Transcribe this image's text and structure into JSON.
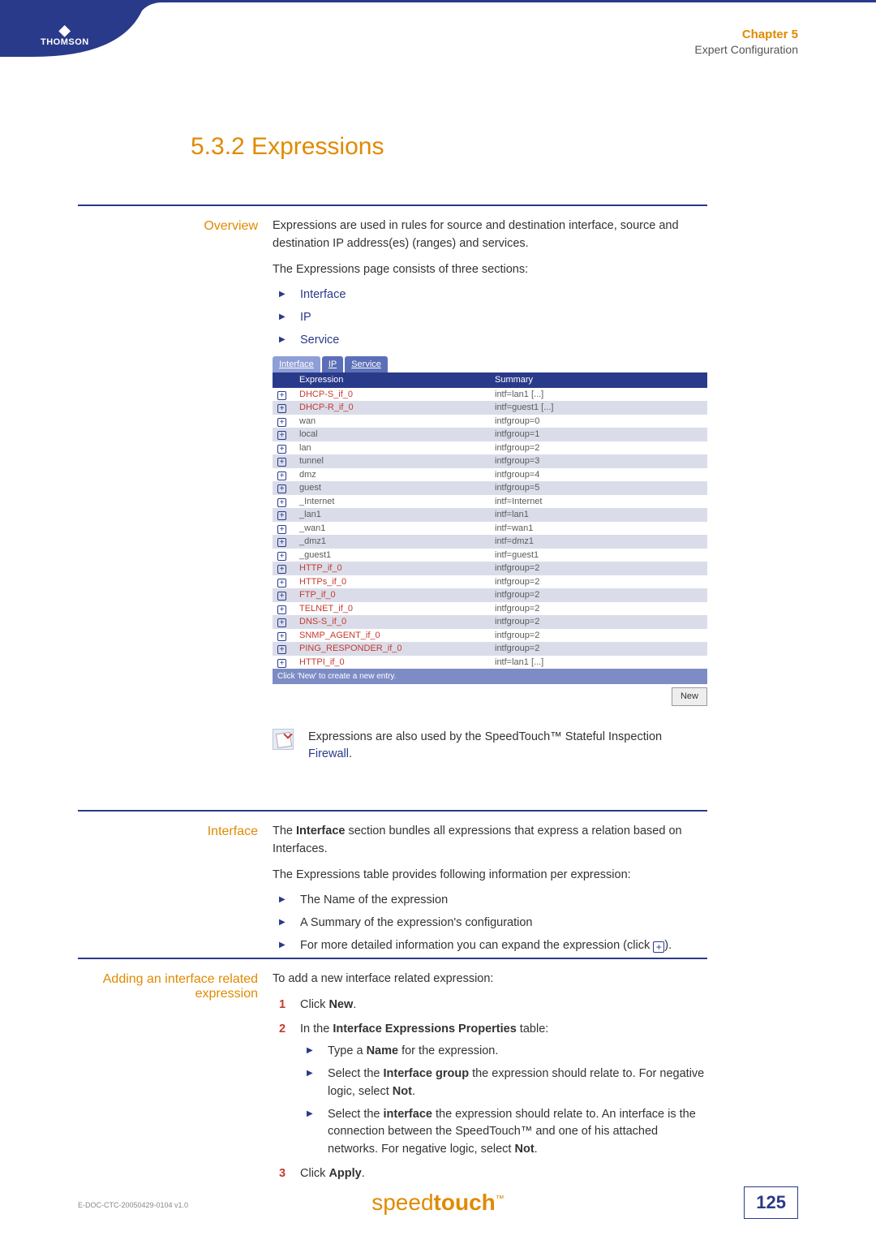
{
  "header": {
    "logo_text": "THOMSON",
    "chapter": "Chapter 5",
    "subtitle": "Expert Configuration"
  },
  "heading": "5.3.2  Expressions",
  "overview": {
    "label": "Overview",
    "para1": "Expressions are used in rules for source and destination interface, source and destination IP address(es) (ranges) and services.",
    "para2": "The Expressions page consists of three sections:",
    "items": [
      "Interface",
      "IP",
      "Service"
    ]
  },
  "screenshot": {
    "tabs": [
      "Interface",
      "IP",
      "Service"
    ],
    "active_tab": 0,
    "columns": [
      "Expression",
      "Summary"
    ],
    "rows": [
      {
        "expr": "DHCP-S_if_0",
        "sum": "intf=lan1 [...]",
        "red": true
      },
      {
        "expr": "DHCP-R_if_0",
        "sum": "intf=guest1 [...]",
        "red": true
      },
      {
        "expr": "wan",
        "sum": "intfgroup=0",
        "red": false
      },
      {
        "expr": "local",
        "sum": "intfgroup=1",
        "red": false
      },
      {
        "expr": "lan",
        "sum": "intfgroup=2",
        "red": false
      },
      {
        "expr": "tunnel",
        "sum": "intfgroup=3",
        "red": false
      },
      {
        "expr": "dmz",
        "sum": "intfgroup=4",
        "red": false
      },
      {
        "expr": "guest",
        "sum": "intfgroup=5",
        "red": false
      },
      {
        "expr": "_Internet",
        "sum": "intf=Internet",
        "red": false
      },
      {
        "expr": "_lan1",
        "sum": "intf=lan1",
        "red": false
      },
      {
        "expr": "_wan1",
        "sum": "intf=wan1",
        "red": false
      },
      {
        "expr": "_dmz1",
        "sum": "intf=dmz1",
        "red": false
      },
      {
        "expr": "_guest1",
        "sum": "intf=guest1",
        "red": false
      },
      {
        "expr": "HTTP_if_0",
        "sum": "intfgroup=2",
        "red": true
      },
      {
        "expr": "HTTPs_if_0",
        "sum": "intfgroup=2",
        "red": true
      },
      {
        "expr": "FTP_if_0",
        "sum": "intfgroup=2",
        "red": true
      },
      {
        "expr": "TELNET_if_0",
        "sum": "intfgroup=2",
        "red": true
      },
      {
        "expr": "DNS-S_if_0",
        "sum": "intfgroup=2",
        "red": true
      },
      {
        "expr": "SNMP_AGENT_if_0",
        "sum": "intfgroup=2",
        "red": true
      },
      {
        "expr": "PING_RESPONDER_if_0",
        "sum": "intfgroup=2",
        "red": true
      },
      {
        "expr": "HTTPI_if_0",
        "sum": "intf=lan1 [...]",
        "red": true
      }
    ],
    "footer_hint": "Click 'New' to create a new entry.",
    "new_button": "New"
  },
  "note": {
    "text_a": "Expressions are also used by the SpeedTouch™ Stateful Inspection ",
    "link": "Firewall",
    "text_b": "."
  },
  "interface_section": {
    "label": "Interface",
    "para1_a": "The ",
    "para1_b": "Interface",
    "para1_c": " section bundles all expressions that express a relation based on Interfaces.",
    "para2": "The Expressions table provides following information per expression:",
    "items": [
      "The Name of the expression",
      "A Summary of the expression's configuration"
    ],
    "item3_a": "For more detailed information you can expand the expression (click ",
    "item3_b": ")."
  },
  "adding_section": {
    "label": "Adding an interface related expression",
    "para1": "To add a new interface related expression:",
    "step1_a": "Click ",
    "step1_b": "New",
    "step1_c": ".",
    "step2_a": "In the ",
    "step2_b": "Interface Expressions Properties",
    "step2_c": " table:",
    "sub1_a": "Type a ",
    "sub1_b": "Name",
    "sub1_c": " for the expression.",
    "sub2_a": "Select the ",
    "sub2_b": "Interface group",
    "sub2_c": " the expression should relate to. For negative logic, select ",
    "sub2_d": "Not",
    "sub2_e": ".",
    "sub3_a": "Select the ",
    "sub3_b": "interface",
    "sub3_c": " the expression should relate to. An interface is the connection between the SpeedTouch™ and one of his attached networks. For negative logic, select ",
    "sub3_d": "Not",
    "sub3_e": ".",
    "step3_a": "Click ",
    "step3_b": "Apply",
    "step3_c": "."
  },
  "footer": {
    "brand_a": "speed",
    "brand_b": "touch",
    "doc_id": "E-DOC-CTC-20050429-0104 v1.0",
    "page": "125"
  }
}
